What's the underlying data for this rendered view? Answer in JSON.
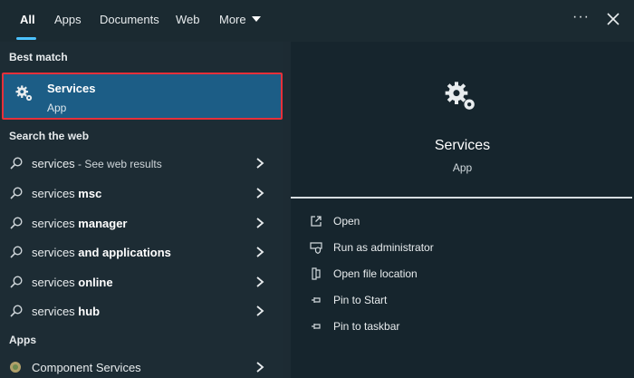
{
  "tabs": [
    {
      "label": "All",
      "active": true
    },
    {
      "label": "Apps"
    },
    {
      "label": "Documents"
    },
    {
      "label": "Web"
    },
    {
      "label": "More"
    }
  ],
  "icons": {
    "more": "more-options-icon",
    "close": "close-icon",
    "gear": "gear-icon",
    "search": "search-icon",
    "chevron": "chevron-right-icon"
  },
  "colors": {
    "accent": "#4cc2ff",
    "selected_bg": "#1c5d86",
    "highlight_border": "#e6303a"
  },
  "best_match": {
    "label": "Best match",
    "title": "Services",
    "subtitle": "App"
  },
  "web": {
    "label": "Search the web",
    "items": [
      {
        "query": "services",
        "suffix": " - See web results",
        "bold": ""
      },
      {
        "query": "services ",
        "suffix": "",
        "bold": "msc"
      },
      {
        "query": "services ",
        "suffix": "",
        "bold": "manager"
      },
      {
        "query": "services ",
        "suffix": "",
        "bold": "and applications"
      },
      {
        "query": "services ",
        "suffix": "",
        "bold": "online"
      },
      {
        "query": "services ",
        "suffix": "",
        "bold": "hub"
      }
    ]
  },
  "apps": {
    "label": "Apps",
    "items": [
      {
        "label": "Component Services"
      }
    ]
  },
  "detail": {
    "title": "Services",
    "subtitle": "App",
    "actions": [
      {
        "label": "Open",
        "icon": "open-icon"
      },
      {
        "label": "Run as administrator",
        "icon": "shield-icon"
      },
      {
        "label": "Open file location",
        "icon": "folder-icon"
      },
      {
        "label": "Pin to Start",
        "icon": "pin-icon"
      },
      {
        "label": "Pin to taskbar",
        "icon": "pin-icon"
      }
    ]
  }
}
